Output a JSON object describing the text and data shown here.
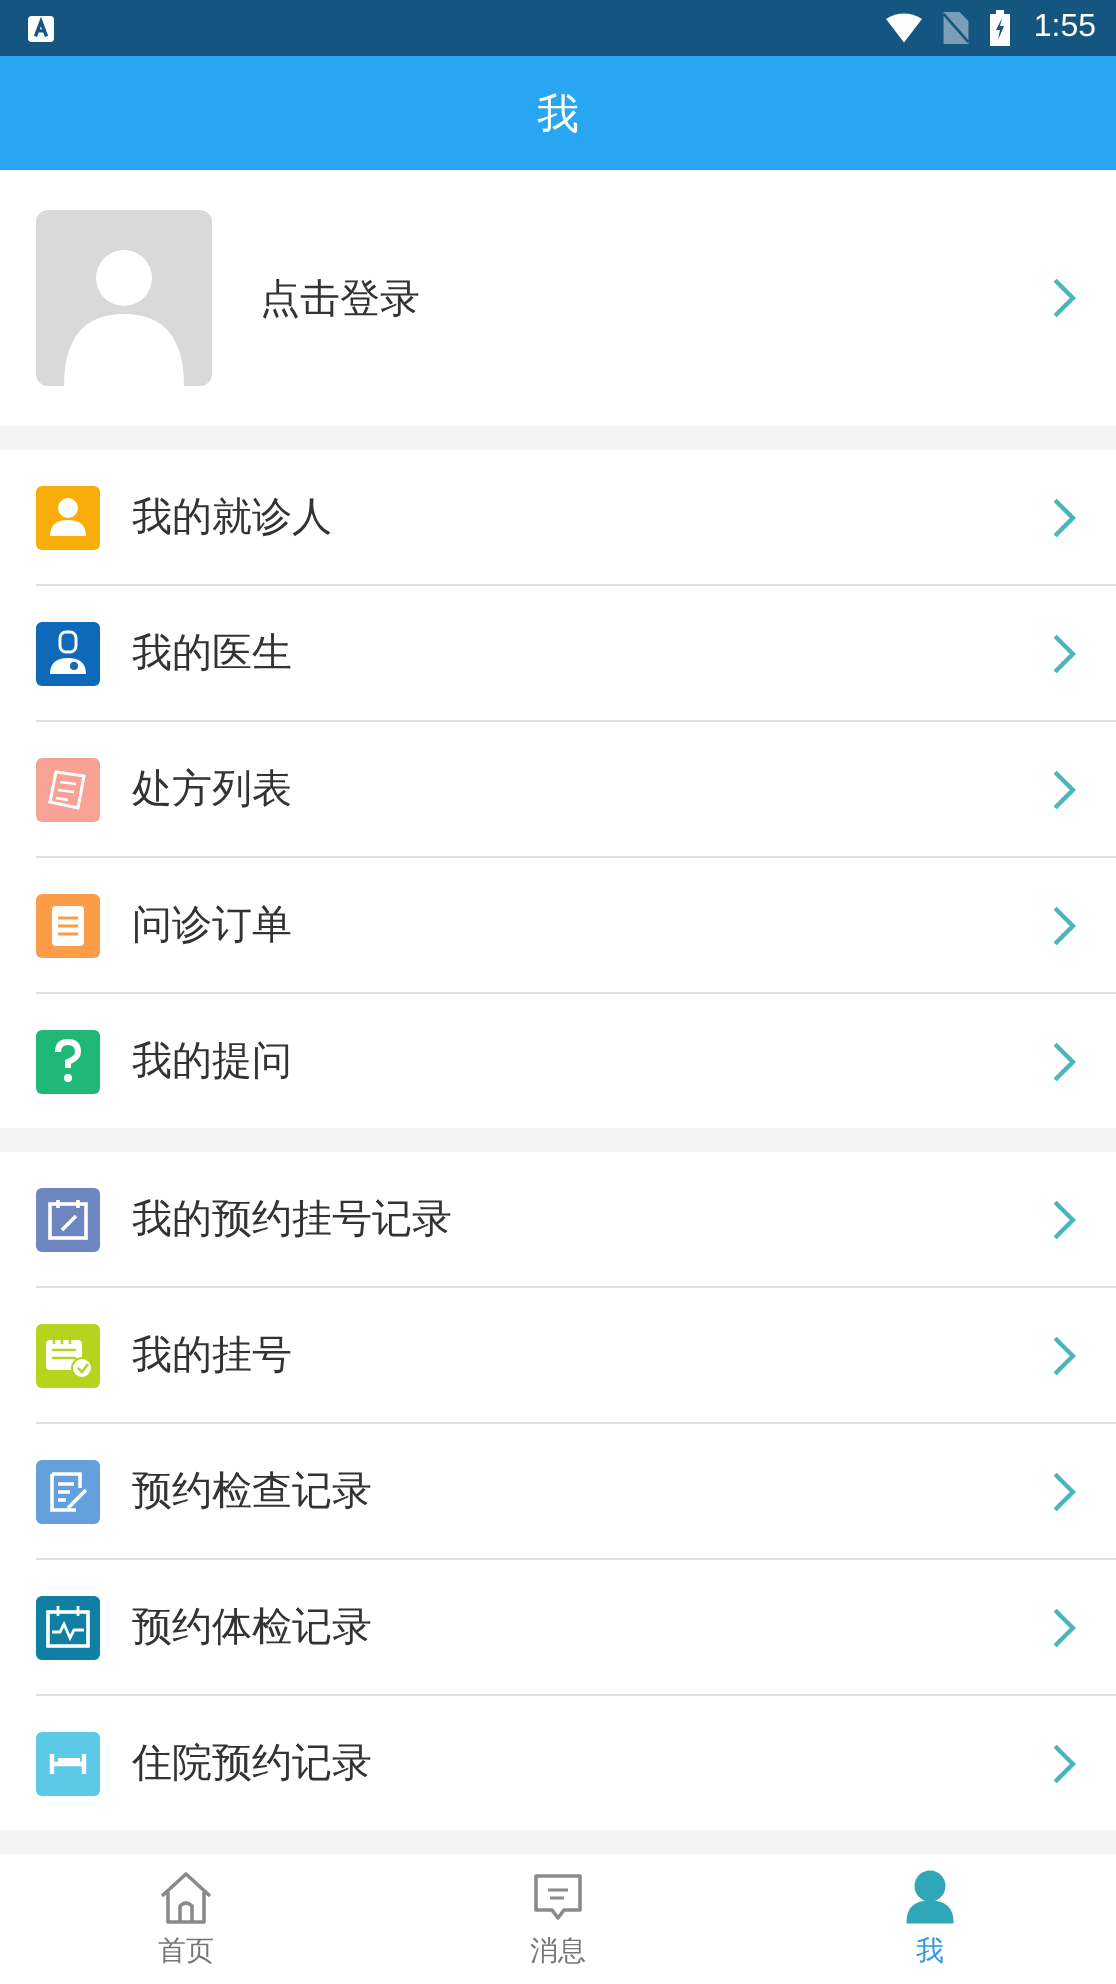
{
  "status_bar": {
    "time": "1:55"
  },
  "header": {
    "title": "我"
  },
  "profile": {
    "label": "点击登录"
  },
  "menu_groups": [
    {
      "items": [
        {
          "label": "我的就诊人",
          "kind": "person",
          "color": "#f9ad0b"
        },
        {
          "label": "我的医生",
          "kind": "doctor",
          "color": "#0e6ab8"
        },
        {
          "label": "处方列表",
          "kind": "prescription",
          "color": "#f8a295"
        },
        {
          "label": "问诊订单",
          "kind": "order",
          "color": "#fc9c48"
        },
        {
          "label": "我的提问",
          "kind": "question",
          "color": "#1fb877"
        }
      ]
    },
    {
      "items": [
        {
          "label": "我的预约挂号记录",
          "kind": "calendar-edit",
          "color": "#6f87c1"
        },
        {
          "label": "我的挂号",
          "kind": "calendar-check",
          "color": "#b6d31e"
        },
        {
          "label": "预约检查记录",
          "kind": "notepad",
          "color": "#64a0dc"
        },
        {
          "label": "预约体检记录",
          "kind": "calendar-pulse",
          "color": "#0f7fa2"
        },
        {
          "label": "住院预约记录",
          "kind": "bed",
          "color": "#5cc9e6"
        }
      ]
    }
  ],
  "tab_bar": [
    {
      "label": "首页",
      "kind": "home",
      "selected": false
    },
    {
      "label": "消息",
      "kind": "message",
      "selected": false
    },
    {
      "label": "我",
      "kind": "person",
      "selected": true
    }
  ]
}
